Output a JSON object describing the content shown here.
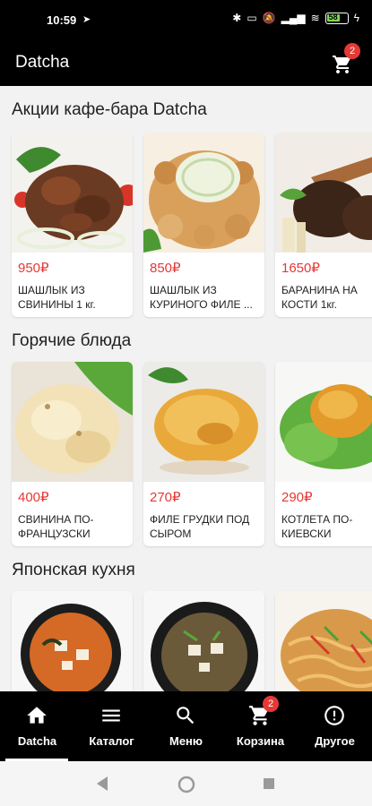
{
  "status_bar": {
    "time": "10:59",
    "battery": "58"
  },
  "app_bar": {
    "title": "Datcha",
    "cart_count": "2"
  },
  "sections": [
    {
      "title": "Акции кафе-бара Datcha",
      "items": [
        {
          "price": "950₽",
          "name": "ШАШЛЫК ИЗ СВИНИНЫ 1 кг."
        },
        {
          "price": "850₽",
          "name": "ШАШЛЫК ИЗ КУРИНОГО ФИЛЕ ..."
        },
        {
          "price": "1650₽",
          "name": "БАРАНИНА НА КОСТИ 1кг."
        }
      ]
    },
    {
      "title": "Горячие блюда",
      "items": [
        {
          "price": "400₽",
          "name": "СВИНИНА ПО-ФРАНЦУЗСКИ"
        },
        {
          "price": "270₽",
          "name": "ФИЛЕ ГРУДКИ ПОД СЫРОМ"
        },
        {
          "price": "290₽",
          "name": "КОТЛЕТА ПО-КИЕВСКИ"
        }
      ]
    },
    {
      "title": "Японская кухня",
      "items": [
        {
          "price": "",
          "name": ""
        },
        {
          "price": "",
          "name": ""
        },
        {
          "price": "",
          "name": ""
        }
      ]
    }
  ],
  "bottom_nav": {
    "items": [
      {
        "label": "Datcha",
        "icon": "home-icon"
      },
      {
        "label": "Каталог",
        "icon": "menu-lines-icon"
      },
      {
        "label": "Меню",
        "icon": "search-icon"
      },
      {
        "label": "Корзина",
        "icon": "cart-icon"
      },
      {
        "label": "Другое",
        "icon": "info-icon"
      }
    ],
    "cart_badge": "2"
  },
  "colors": {
    "accent": "#e53935",
    "bar": "#000000",
    "background": "#f2f2f2"
  }
}
